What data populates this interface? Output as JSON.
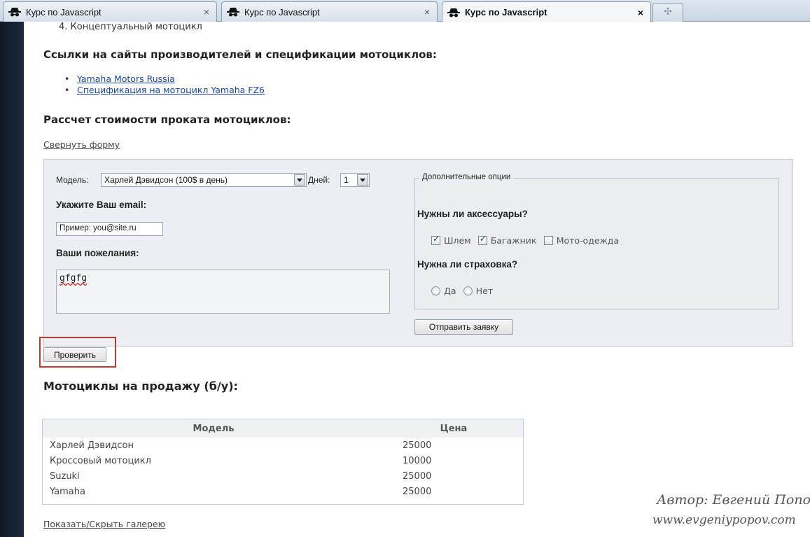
{
  "browser": {
    "tabs": [
      {
        "title": "Курс по Javascript",
        "close": "×",
        "active": false
      },
      {
        "title": "Курс по Javascript",
        "close": "×",
        "active": false
      },
      {
        "title": "Курс по Javascript",
        "close": "×",
        "active": true
      }
    ],
    "new_tab_icon": "plus-icon"
  },
  "page": {
    "list_item": "4.  Концептуальный мотоцикл",
    "links_heading": "Ссылки на сайты производителей и спецификации мотоциклов:",
    "links": [
      {
        "text": "Yamaha Motors Russia"
      },
      {
        "text": "Спецификация на мотоцикл Yamaha FZ6"
      }
    ],
    "rental_heading": "Рассчет стоимости проката мотоциклов:",
    "collapse_link": "Свернуть форму",
    "form": {
      "model_label": "Модель:",
      "model_value": "Харлей Дэвидсон (100$ в день)",
      "days_label": "Дней:",
      "days_value": "1",
      "email_label": "Укажите Ваш email:",
      "email_value": "Пример: you@site.ru",
      "wishes_label": "Ваши пожелания:",
      "wishes_value": "gfgfg",
      "options_legend": "Дополнительные опции",
      "accessories_question": "Нужны ли аксессуары?",
      "accessories": [
        {
          "label": "Шлем",
          "checked": true
        },
        {
          "label": "Багажник",
          "checked": true
        },
        {
          "label": "Мото-одежда",
          "checked": false
        }
      ],
      "insurance_question": "Нужна ли страховка?",
      "insurance_options": [
        {
          "label": "Да",
          "selected": false
        },
        {
          "label": "Нет",
          "selected": false
        }
      ],
      "submit_label": "Отправить заявку"
    },
    "check_button": "Проверить",
    "sale_heading": "Мотоциклы на продажу (б/у):",
    "sale_table": {
      "headers": [
        "Модель",
        "Цена"
      ],
      "rows": [
        [
          "Харлей Дэвидсон",
          "25000"
        ],
        [
          "Кроссовый мотоцикл",
          "10000"
        ],
        [
          "Suzuki",
          "25000"
        ],
        [
          "Yamaha",
          "25000"
        ]
      ]
    },
    "gallery_link": "Показать/Скрыть галерею"
  },
  "watermark": {
    "author": "Автор: Евгений Попо",
    "site": "www.evgeniypopov.com"
  },
  "colors": {
    "link": "#1a46a8",
    "highlight": "#c0392b",
    "form_bg": "#eceef3"
  }
}
